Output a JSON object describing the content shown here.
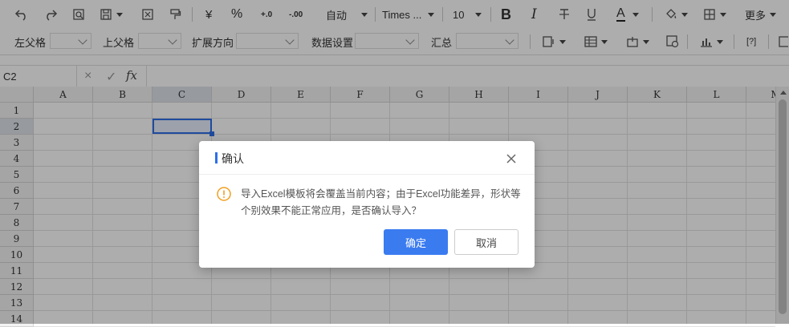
{
  "toolbar": {
    "number_format": "自动",
    "font_family": "Times ...",
    "font_size": "10",
    "currency_symbol": "¥",
    "percent_symbol": "%",
    "decimal_increase": "+.0",
    "decimal_decrease": "-.00",
    "bold": "B",
    "italic": "I",
    "font_color": "A",
    "more_label": "更多",
    "icons": [
      "undo-icon",
      "redo-icon",
      "preview-icon",
      "save-icon",
      "export-icon",
      "format-painter-icon",
      "strikethrough-icon",
      "underline-icon",
      "fill-color-icon",
      "border-icon"
    ]
  },
  "toolbar2": {
    "left_parent": "左父格",
    "top_parent": "上父格",
    "expand_direction": "扩展方向",
    "data_setting": "数据设置",
    "summary": "汇总",
    "icons": [
      "insert-image-icon",
      "table-icon",
      "cell-type-icon",
      "formula-icon",
      "chart-icon",
      "code-icon",
      "extra-icon"
    ]
  },
  "formula_bar": {
    "name_box": "C2",
    "cancel_symbol": "×",
    "confirm_symbol": "✓",
    "fx_symbol": "fx"
  },
  "sheet": {
    "columns": [
      "A",
      "B",
      "C",
      "D",
      "E",
      "F",
      "G",
      "H",
      "I",
      "J",
      "K",
      "L",
      "M"
    ],
    "rows": [
      "1",
      "2",
      "3",
      "4",
      "5",
      "6",
      "7",
      "8",
      "9",
      "10",
      "11",
      "12",
      "13",
      "14"
    ],
    "selected_cell": "C2"
  },
  "dialog": {
    "title": "确认",
    "message": "导入Excel模板将会覆盖当前内容；由于Excel功能差异，形状等个别效果不能正常应用，是否确认导入？",
    "ok_label": "确定",
    "cancel_label": "取消",
    "accent_color": "#3a7bf0",
    "warning_color": "#f0a020"
  }
}
